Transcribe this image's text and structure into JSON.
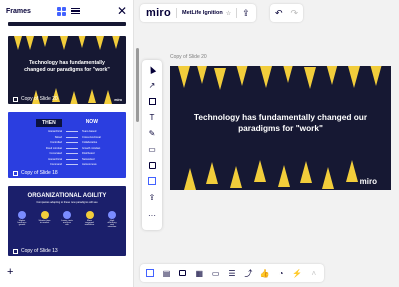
{
  "panel": {
    "title": "Frames",
    "add_label": "+",
    "close_label": "✕"
  },
  "frames": [
    {
      "label": "Copy of Slide 20",
      "title": "Technology has fundamentally changed our paradigms for \"work\"",
      "logo": "miro"
    },
    {
      "label": "Copy of Slide 18",
      "then": "THEN",
      "now": "NOW",
      "rows": [
        [
          "Hierarchical",
          "Team-based"
        ],
        [
          "Siloed",
          "Cross-functional"
        ],
        [
          "Controlled",
          "Collaborative"
        ],
        [
          "Fixed mindset",
          "Growth mindset"
        ],
        [
          "Co-located",
          "Distributed"
        ],
        [
          "Hierarchical",
          "Networked"
        ],
        [
          "Command",
          "Autonomous"
        ]
      ]
    },
    {
      "label": "Copy of Slide 13",
      "title": "ORGANIZATIONAL AGILITY",
      "subtitle": "Companies adapting to these new paradigms will see",
      "icons": [
        "Higher business growth",
        "Shorter time to market",
        "Lower costs and less risk",
        "More engaged workforce",
        "High efficiency and retention"
      ]
    }
  ],
  "topbar": {
    "logo": "miro",
    "board_name": "MetLife Ignition",
    "star": "☆",
    "share": "⇪",
    "undo": "↶",
    "redo": "↷"
  },
  "canvas": {
    "frame_label": "Copy of Slide 20",
    "slide_title": "Technology has fundamentally changed our paradigms for \"work\"",
    "slide_logo": "miro"
  },
  "tools": {
    "pen": "✎",
    "text": "T",
    "line": "↗",
    "comment": "▭",
    "upload": "⇪",
    "more": "···"
  },
  "bottom_tools": [
    "▤",
    "▦",
    "▭",
    "☰",
    "⤴",
    "👍",
    "◔",
    "⚡",
    "˄"
  ],
  "colors": {
    "accent": "#4262ff",
    "slide_bg": "#161833",
    "slide_accent": "#f2cd3b",
    "then_now_bg": "#2b3ee0",
    "agility_bg": "#1b1f6b"
  }
}
